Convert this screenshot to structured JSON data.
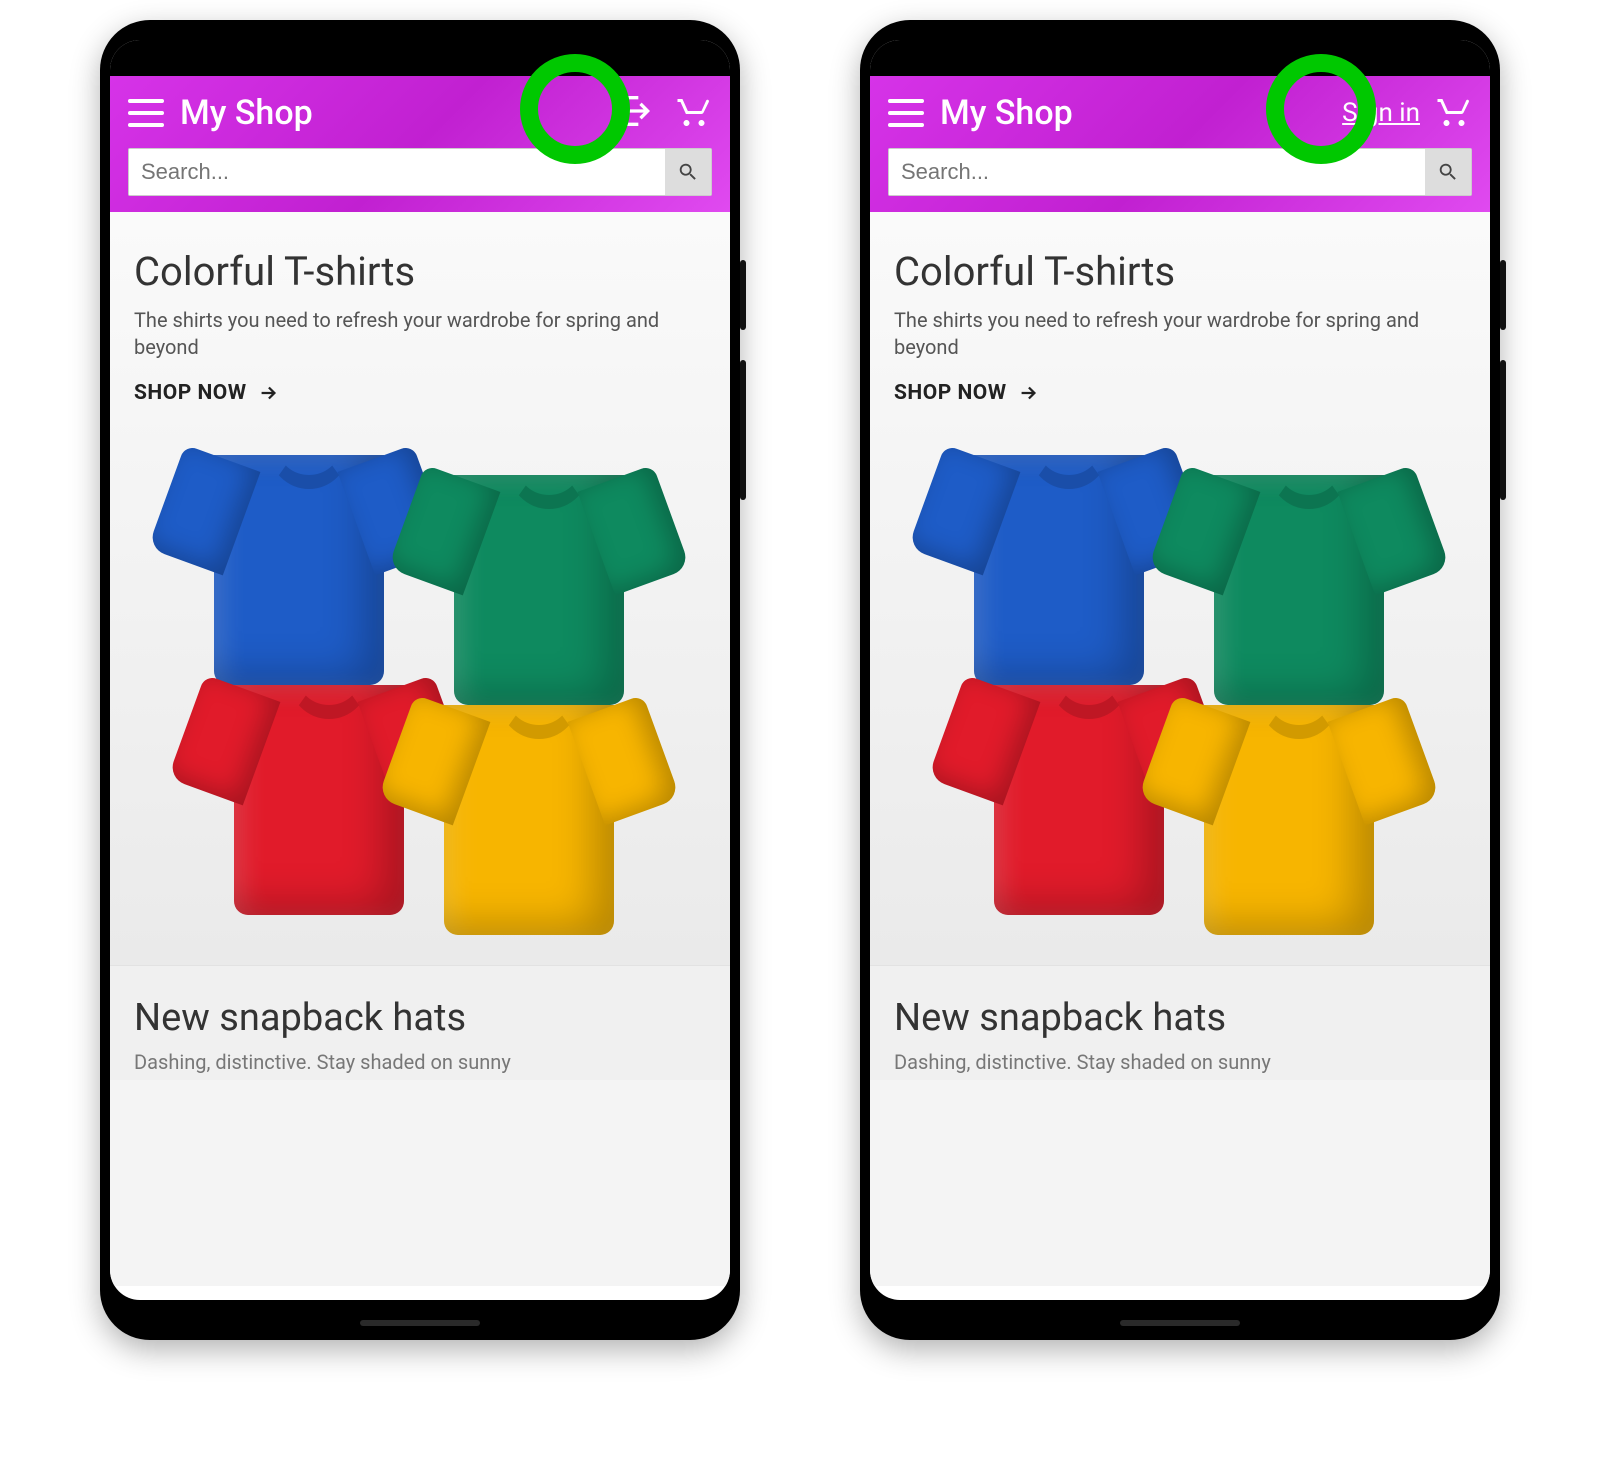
{
  "header": {
    "app_title": "My Shop",
    "signin_label": "Sign in"
  },
  "search": {
    "placeholder": "Search..."
  },
  "hero": {
    "title": "Colorful T-shirts",
    "subtitle": "The shirts you need to refresh your wardrobe for spring and beyond",
    "cta": "SHOP NOW"
  },
  "section2": {
    "title": "New snapback hats",
    "subtitle_partial": "Dashing, distinctive. Stay shaded on sunny"
  },
  "colors": {
    "accent": "#d633e8",
    "highlight": "#00c800",
    "tshirt_blue": "#1e5cc7",
    "tshirt_green": "#0e8a5f",
    "tshirt_red": "#e11b2a",
    "tshirt_yellow": "#f7b500"
  },
  "variants": [
    {
      "login_display": "icon"
    },
    {
      "login_display": "text"
    }
  ]
}
